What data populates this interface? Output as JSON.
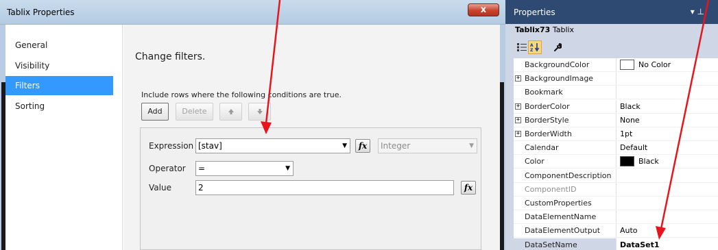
{
  "dialog": {
    "title": "Tablix Properties",
    "close_glyph": "x",
    "nav": [
      {
        "label": "General",
        "selected": false
      },
      {
        "label": "Visibility",
        "selected": false
      },
      {
        "label": "Filters",
        "selected": true
      },
      {
        "label": "Sorting",
        "selected": false
      }
    ],
    "heading": "Change filters.",
    "description": "Include rows where the following conditions are true.",
    "buttons": {
      "add": "Add",
      "delete": "Delete"
    },
    "filter": {
      "expression_label": "Expression",
      "expression_value": "[stav]",
      "type_value": "Integer",
      "operator_label": "Operator",
      "operator_value": "=",
      "value_label": "Value",
      "value_value": "2",
      "fx_glyph": "fx"
    }
  },
  "properties": {
    "title": "Properties",
    "pin_glyph": "▾ ⊥",
    "object_name": "Tablix73",
    "object_type": "Tablix",
    "rows": [
      {
        "name": "BackgroundColor",
        "value": "No Color",
        "expandable": false,
        "swatch": "#ffffff",
        "bold": false,
        "dim": false
      },
      {
        "name": "BackgroundImage",
        "value": "",
        "expandable": true,
        "swatch": null,
        "bold": false,
        "dim": false
      },
      {
        "name": "Bookmark",
        "value": "",
        "expandable": false,
        "swatch": null,
        "bold": false,
        "dim": false
      },
      {
        "name": "BorderColor",
        "value": "Black",
        "expandable": true,
        "swatch": null,
        "bold": false,
        "dim": false
      },
      {
        "name": "BorderStyle",
        "value": "None",
        "expandable": true,
        "swatch": null,
        "bold": false,
        "dim": false
      },
      {
        "name": "BorderWidth",
        "value": "1pt",
        "expandable": true,
        "swatch": null,
        "bold": false,
        "dim": false
      },
      {
        "name": "Calendar",
        "value": "Default",
        "expandable": false,
        "swatch": null,
        "bold": false,
        "dim": false
      },
      {
        "name": "Color",
        "value": "Black",
        "expandable": false,
        "swatch": "#000000",
        "bold": false,
        "dim": false
      },
      {
        "name": "ComponentDescription",
        "value": "",
        "expandable": false,
        "swatch": null,
        "bold": false,
        "dim": false
      },
      {
        "name": "ComponentID",
        "value": "",
        "expandable": false,
        "swatch": null,
        "bold": false,
        "dim": true
      },
      {
        "name": "CustomProperties",
        "value": "",
        "expandable": false,
        "swatch": null,
        "bold": false,
        "dim": false
      },
      {
        "name": "DataElementName",
        "value": "",
        "expandable": false,
        "swatch": null,
        "bold": false,
        "dim": false
      },
      {
        "name": "DataElementOutput",
        "value": "Auto",
        "expandable": false,
        "swatch": null,
        "bold": false,
        "dim": false
      },
      {
        "name": "DataSetName",
        "value": "DataSet1",
        "expandable": false,
        "swatch": null,
        "bold": true,
        "dim": false,
        "selected": true
      }
    ]
  },
  "colors": {
    "selection": "#3399ff",
    "properties_header": "#2e4a73",
    "annotation_arrow": "#e8141c"
  }
}
